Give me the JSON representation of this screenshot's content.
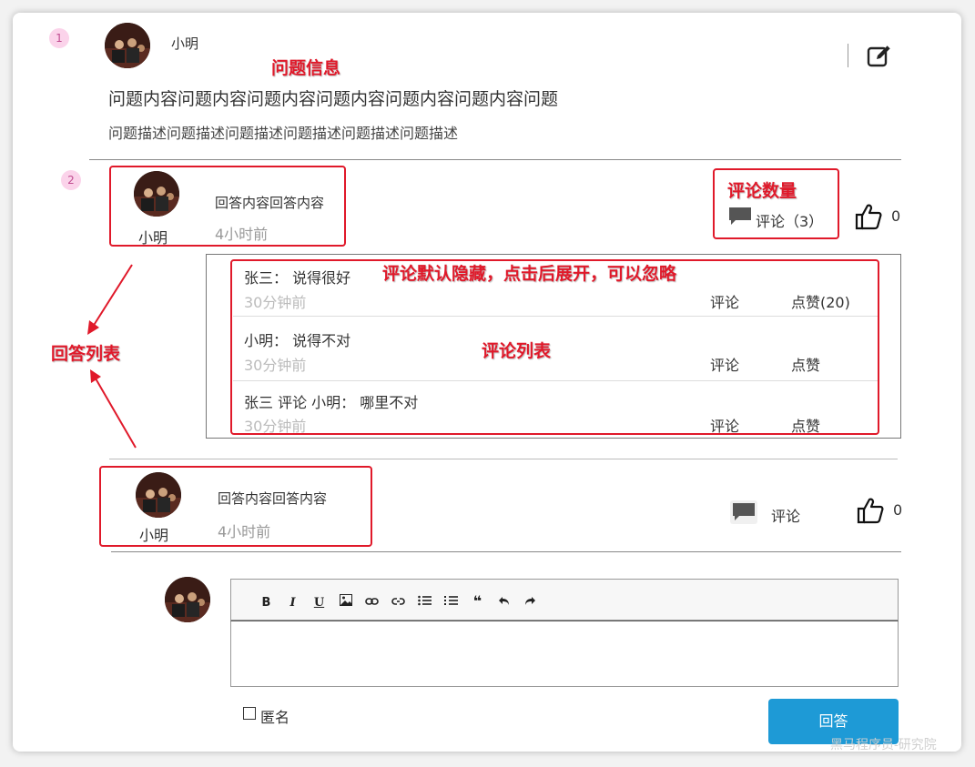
{
  "question": {
    "index": "1",
    "user": "小明",
    "annotation": "问题信息",
    "title": "问题内容问题内容问题内容问题内容问题内容问题内容问题",
    "description": "问题描述问题描述问题描述问题描述问题描述问题描述"
  },
  "answer_index": "2",
  "annotations": {
    "comment_count": "评论数量",
    "hidden_comments": "评论默认隐藏，点击后展开，可以忽略",
    "comment_list": "评论列表",
    "answer_list": "回答列表"
  },
  "answers": [
    {
      "user": "小明",
      "content": "回答内容回答内容",
      "time": "4小时前",
      "comment_label": "评论（3）",
      "like_count": "0"
    },
    {
      "user": "小明",
      "content": "回答内容回答内容",
      "time": "4小时前",
      "comment_label": "评论",
      "like_count": "0"
    }
  ],
  "comments": [
    {
      "text": "张三：  说得很好",
      "time": "30分钟前",
      "reply_label": "评论",
      "like_label": "点赞(20)"
    },
    {
      "text": "小明：  说得不对",
      "time": "30分钟前",
      "reply_label": "评论",
      "like_label": "点赞"
    },
    {
      "text": "张三 评论  小明：  哪里不对",
      "time": "30分钟前",
      "reply_label": "评论",
      "like_label": "点赞"
    }
  ],
  "editor": {
    "toolbar": [
      "B",
      "I",
      "U",
      "image-icon",
      "link-icon",
      "unlink-icon",
      "bullet-list-icon",
      "numbered-list-icon",
      "quote-icon",
      "undo-icon",
      "redo-icon"
    ],
    "anonymous_label": "匿名",
    "submit_label": "回答"
  },
  "watermark": "黑马程序员-研究院",
  "colors": {
    "accent": "#1e9ad6",
    "annotation": "#e0192a",
    "badge": "#fbd3ea"
  }
}
